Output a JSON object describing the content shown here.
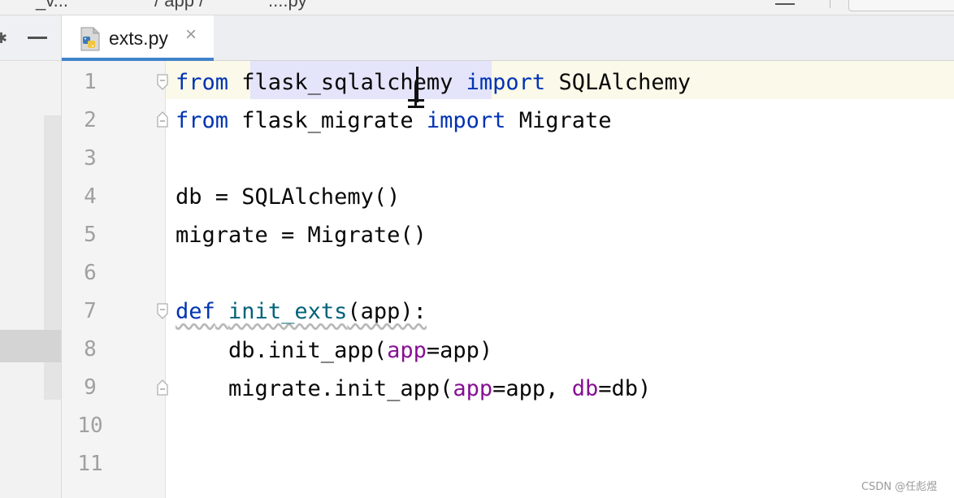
{
  "topbar": {
    "breadcrumb_left": "_v...",
    "breadcrumb_mid": "/ app /",
    "breadcrumb_file": "....py"
  },
  "tab": {
    "label": "exts.py",
    "close": "×",
    "icon": "python-file-icon"
  },
  "line_numbers": [
    "1",
    "2",
    "3",
    "4",
    "5",
    "6",
    "7",
    "8",
    "9",
    "10",
    "11"
  ],
  "code": {
    "l1": {
      "kw1": "from",
      "mod": "flask_sqlalchemy",
      "kw2": "import",
      "name": "SQLAlchemy"
    },
    "l2": {
      "kw1": "from",
      "mod": "flask_migrate",
      "kw2": "import",
      "name": "Migrate"
    },
    "l4": "db = SQLAlchemy()",
    "l5": "migrate = Migrate()",
    "l7": {
      "kw": "def",
      "fn": "init_exts",
      "rest": "(app):"
    },
    "l8": {
      "pre": "    db.init_app(",
      "p1": "app",
      "post": "=app)"
    },
    "l9": {
      "pre": "    migrate.init_app(",
      "p1": "app",
      "mid": "=app, ",
      "p2": "db",
      "post": "=db)"
    }
  },
  "colors": {
    "keyword": "#0033b3",
    "function": "#00627a",
    "param": "#871094",
    "tab_accent": "#4083c9"
  },
  "watermark": "CSDN @任彪煜"
}
